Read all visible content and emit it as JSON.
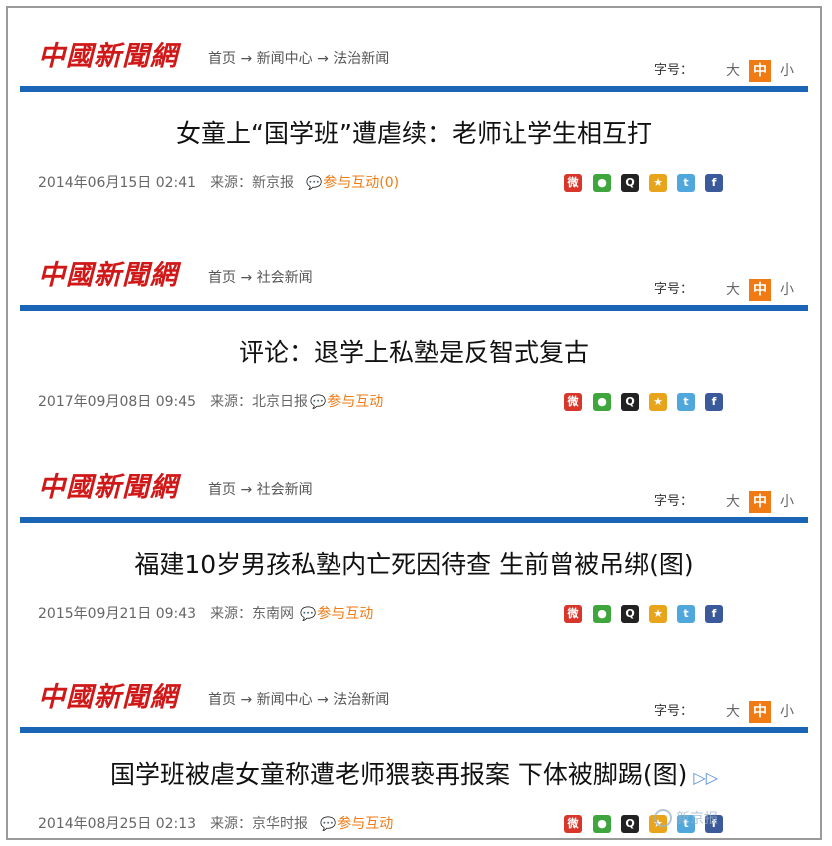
{
  "site": {
    "logo_text": "中國新聞網",
    "font_size_label": "字号：",
    "font_size_options": [
      "大",
      "中",
      "小"
    ],
    "selected_font_size": "中",
    "interact_label_plain": "参与互动",
    "share_icons": [
      "weibo-icon",
      "wechat-icon",
      "qq-icon",
      "qzone-icon",
      "tweibo-icon",
      "facebook-icon"
    ]
  },
  "articles": [
    {
      "breadcrumb": "首页 → 新闻中心 → 法治新闻",
      "headline": "女童上“国学班”遭虐续：老师让学生相互打",
      "datetime": "2014年06月15日 02:41",
      "source": "来源：新京报",
      "interact": "参与互动(0)"
    },
    {
      "breadcrumb": "首页 → 社会新闻",
      "headline": "评论：退学上私塾是反智式复古",
      "datetime": "2017年09月08日 09:45",
      "source": "来源：北京日报",
      "interact": "参与互动"
    },
    {
      "breadcrumb": "首页 → 社会新闻",
      "headline": "福建10岁男孩私塾内亡死因待查 生前曾被吊绑(图)",
      "datetime": "2015年09月21日 09:43",
      "source": "来源：东南网",
      "interact": "参与互动"
    },
    {
      "breadcrumb": "首页 → 新闻中心 → 法治新闻",
      "headline": "国学班被虐女童称遭老师猥亵再报案 下体被脚踢(图)",
      "datetime": "2014年08月25日 02:13",
      "source": "来源：京华时报",
      "interact": "参与互动"
    }
  ],
  "watermark": "新京报"
}
